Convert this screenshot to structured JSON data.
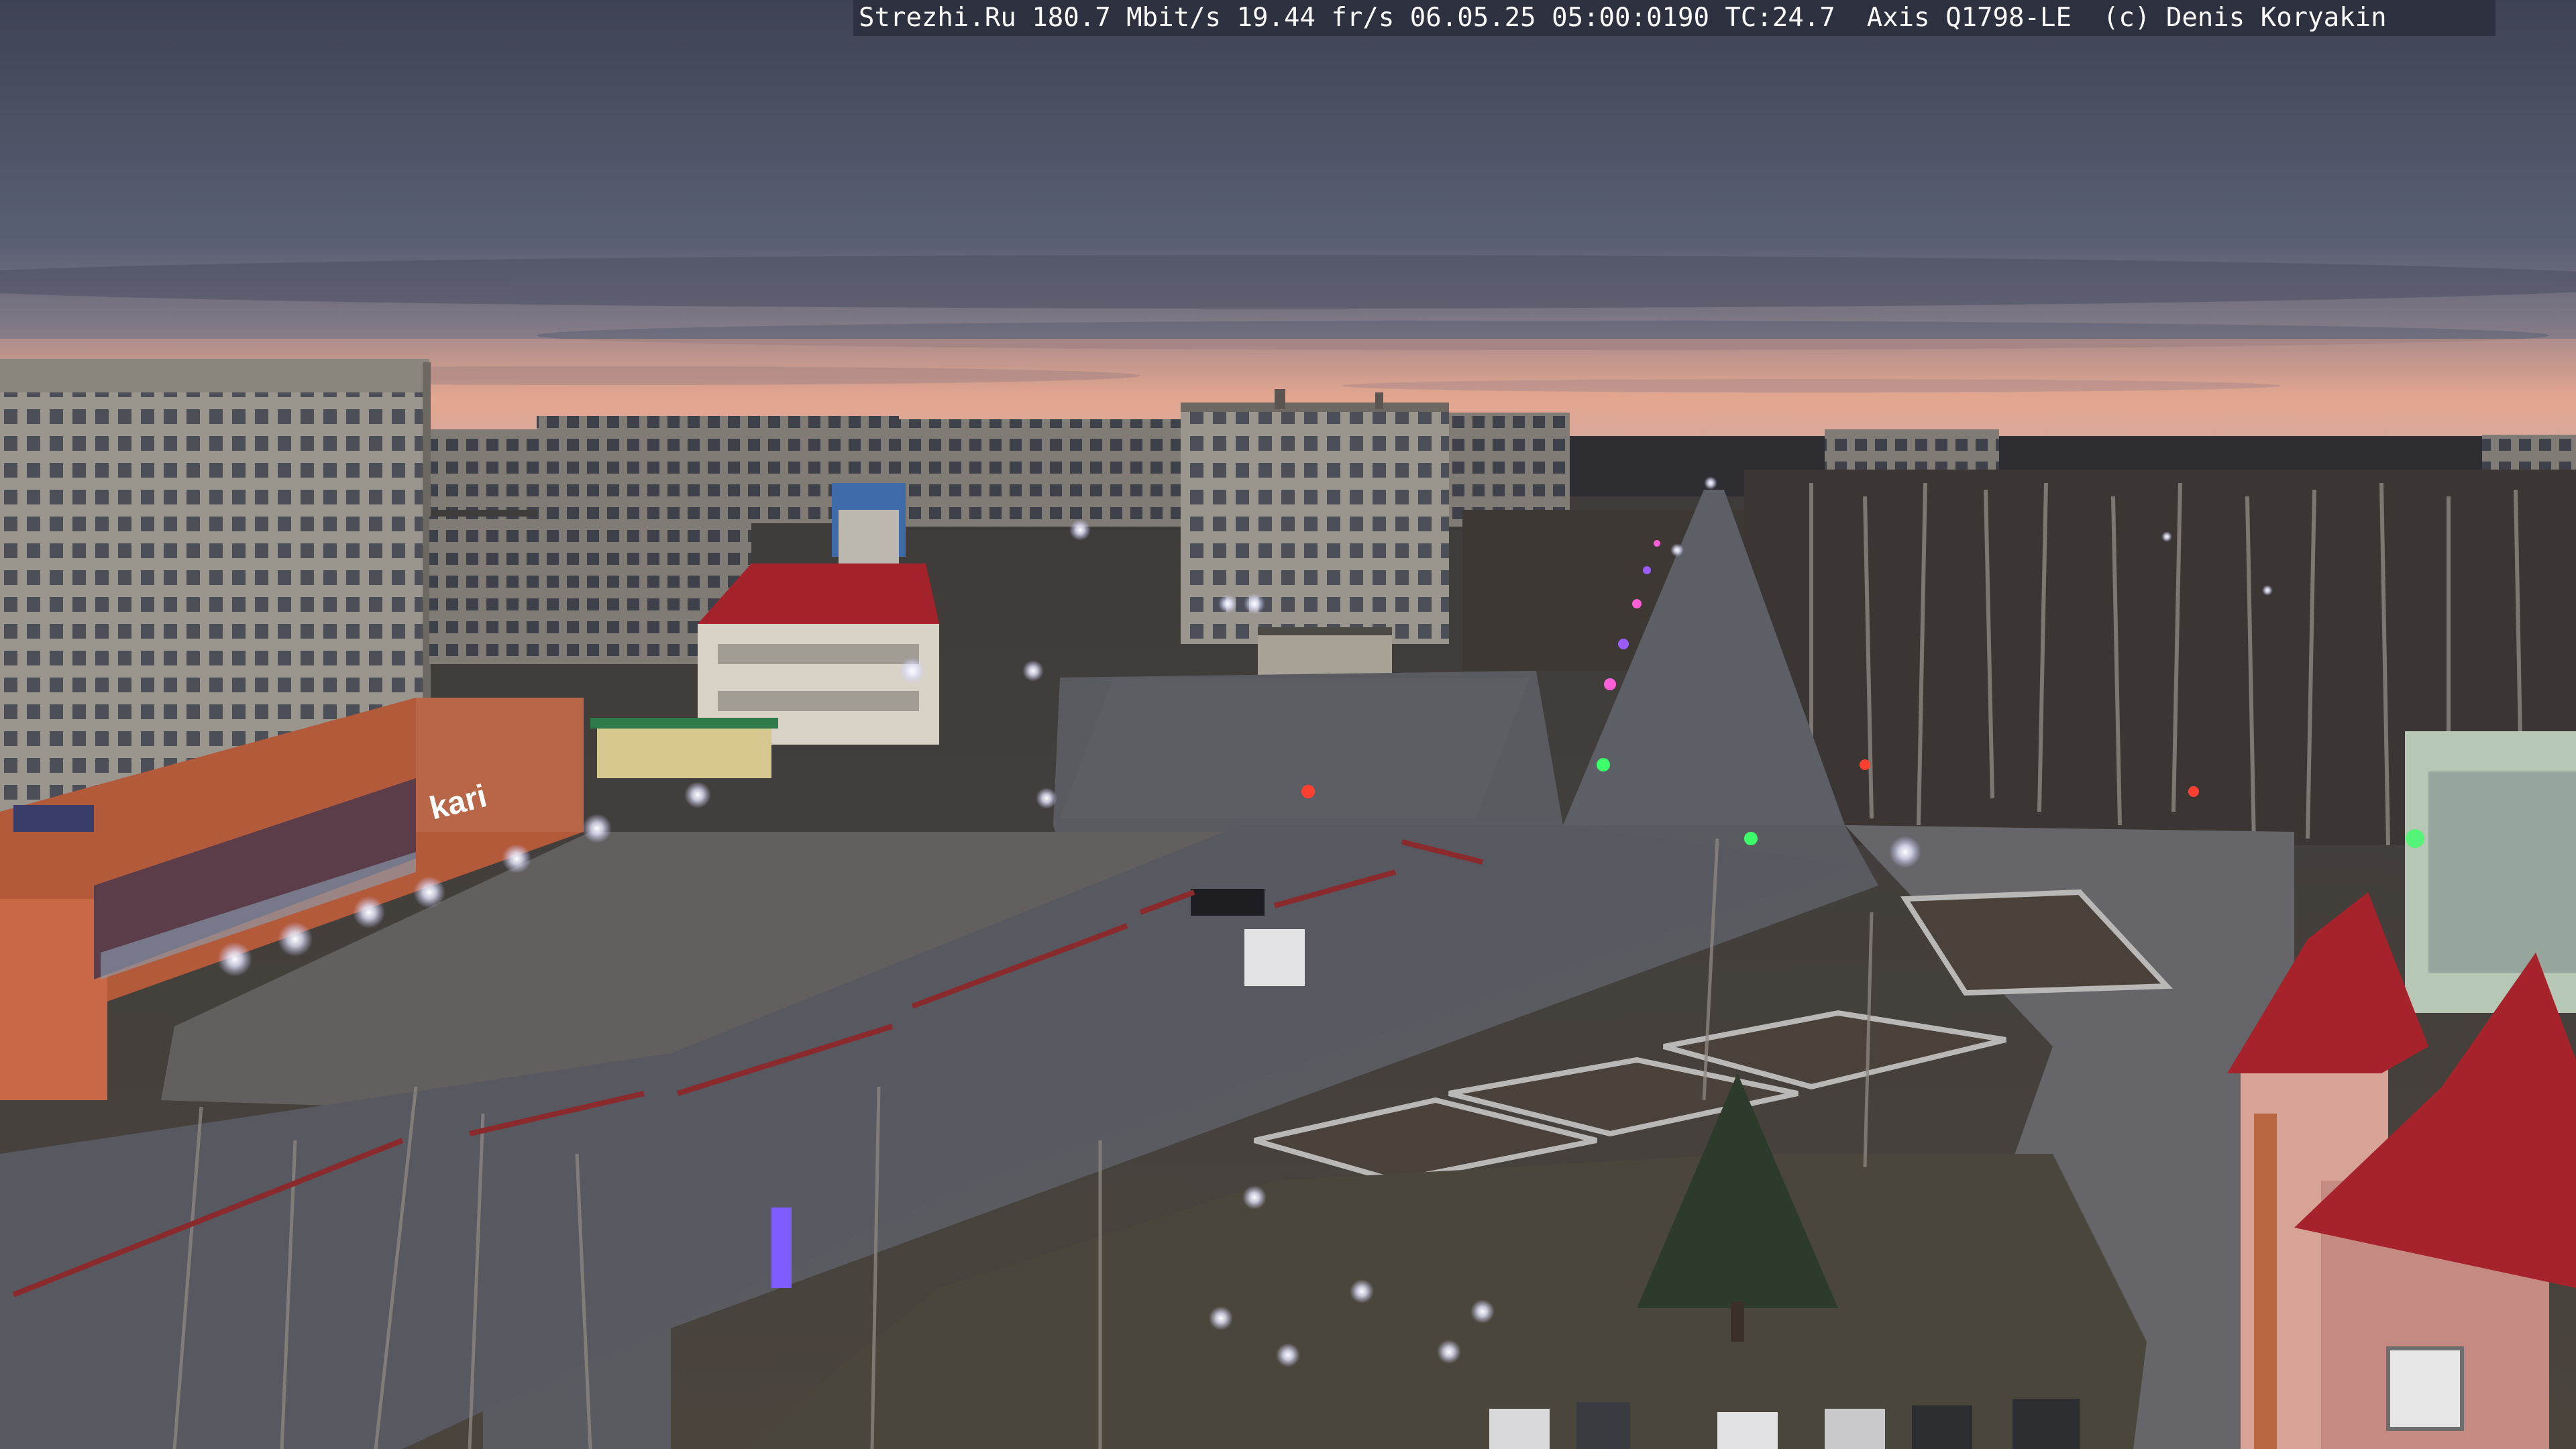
{
  "overlay": {
    "text": "Strezhi.Ru 180.7 Mbit/s 19.44 fr/s 06.05.25 05:00:0190 TC:24.7  Axis Q1798-LE  (c) Denis Koryakin"
  },
  "signs": {
    "kari": "kari"
  },
  "colors": {
    "sky_top": "#3f4454",
    "sky_mid": "#575d70",
    "horizon_glow": "#e6a58e",
    "road": "#585a60",
    "ground": "#4a4540",
    "building_panel": "#8f8a82",
    "roof_red": "#a4232b",
    "shop_facade": "#b35a3a"
  }
}
